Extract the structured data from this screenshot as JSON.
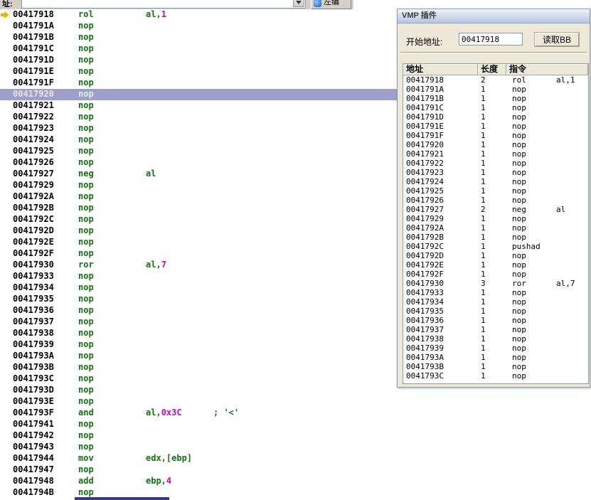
{
  "toolbar": {
    "address_label": "址:",
    "combo_value": "",
    "button_label": "左编"
  },
  "colors": {
    "mnemonic_green": "#0e750e",
    "operand_number_magenta": "#cc00cc",
    "highlight_row_lavender": "#9f9fcc",
    "eip_arrow_gold": "#f0b400",
    "selection_blue": "#34349c",
    "dialog_background": "#ece9d8"
  },
  "disassembly": {
    "lines": [
      {
        "addr": "00417918",
        "mn": "rol",
        "op": [
          {
            "t": "al,",
            "c": "reg"
          },
          {
            "t": "1",
            "c": "num"
          }
        ],
        "arrow": true
      },
      {
        "addr": "0041791A",
        "mn": "nop"
      },
      {
        "addr": "0041791B",
        "mn": "nop"
      },
      {
        "addr": "0041791C",
        "mn": "nop"
      },
      {
        "addr": "0041791D",
        "mn": "nop"
      },
      {
        "addr": "0041791E",
        "mn": "nop"
      },
      {
        "addr": "0041791F",
        "mn": "nop"
      },
      {
        "addr": "00417920",
        "mn": "nop",
        "hl": true
      },
      {
        "addr": "00417921",
        "mn": "nop"
      },
      {
        "addr": "00417922",
        "mn": "nop"
      },
      {
        "addr": "00417923",
        "mn": "nop"
      },
      {
        "addr": "00417924",
        "mn": "nop"
      },
      {
        "addr": "00417925",
        "mn": "nop"
      },
      {
        "addr": "00417926",
        "mn": "nop"
      },
      {
        "addr": "00417927",
        "mn": "neg",
        "op": [
          {
            "t": "al",
            "c": "reg"
          }
        ]
      },
      {
        "addr": "00417929",
        "mn": "nop"
      },
      {
        "addr": "0041792A",
        "mn": "nop"
      },
      {
        "addr": "0041792B",
        "mn": "nop"
      },
      {
        "addr": "0041792C",
        "mn": "nop"
      },
      {
        "addr": "0041792D",
        "mn": "nop"
      },
      {
        "addr": "0041792E",
        "mn": "nop"
      },
      {
        "addr": "0041792F",
        "mn": "nop"
      },
      {
        "addr": "00417930",
        "mn": "ror",
        "op": [
          {
            "t": "al,",
            "c": "reg"
          },
          {
            "t": "7",
            "c": "num"
          }
        ]
      },
      {
        "addr": "00417933",
        "mn": "nop"
      },
      {
        "addr": "00417934",
        "mn": "nop"
      },
      {
        "addr": "00417935",
        "mn": "nop"
      },
      {
        "addr": "00417936",
        "mn": "nop"
      },
      {
        "addr": "00417937",
        "mn": "nop"
      },
      {
        "addr": "00417938",
        "mn": "nop"
      },
      {
        "addr": "00417939",
        "mn": "nop"
      },
      {
        "addr": "0041793A",
        "mn": "nop"
      },
      {
        "addr": "0041793B",
        "mn": "nop"
      },
      {
        "addr": "0041793C",
        "mn": "nop"
      },
      {
        "addr": "0041793D",
        "mn": "nop"
      },
      {
        "addr": "0041793E",
        "mn": "nop"
      },
      {
        "addr": "0041793F",
        "mn": "and",
        "op": [
          {
            "t": "al,",
            "c": "reg"
          },
          {
            "t": "0x3C",
            "c": "num"
          }
        ],
        "comment": "; '<'"
      },
      {
        "addr": "00417941",
        "mn": "nop"
      },
      {
        "addr": "00417942",
        "mn": "nop"
      },
      {
        "addr": "00417943",
        "mn": "nop"
      },
      {
        "addr": "00417944",
        "mn": "mov",
        "op": [
          {
            "t": "edx,[ebp]",
            "c": "reg"
          }
        ]
      },
      {
        "addr": "00417947",
        "mn": "nop"
      },
      {
        "addr": "00417948",
        "mn": "add",
        "op": [
          {
            "t": "ebp,",
            "c": "reg"
          },
          {
            "t": "4",
            "c": "num"
          }
        ]
      },
      {
        "addr": "0041794B",
        "mn": "nop"
      }
    ]
  },
  "dialog": {
    "title": "VMP 插件",
    "start_label": "开始地址:",
    "start_value": "00417918",
    "read_button": "读取BB",
    "table": {
      "headers": [
        "地址",
        "长度",
        "指令"
      ],
      "rows": [
        [
          "00417918",
          "2",
          "rol",
          "al,1"
        ],
        [
          "0041791A",
          "1",
          "nop",
          ""
        ],
        [
          "0041791B",
          "1",
          "nop",
          ""
        ],
        [
          "0041791C",
          "1",
          "nop",
          ""
        ],
        [
          "0041791D",
          "1",
          "nop",
          ""
        ],
        [
          "0041791E",
          "1",
          "nop",
          ""
        ],
        [
          "0041791F",
          "1",
          "nop",
          ""
        ],
        [
          "00417920",
          "1",
          "nop",
          ""
        ],
        [
          "00417921",
          "1",
          "nop",
          ""
        ],
        [
          "00417922",
          "1",
          "nop",
          ""
        ],
        [
          "00417923",
          "1",
          "nop",
          ""
        ],
        [
          "00417924",
          "1",
          "nop",
          ""
        ],
        [
          "00417925",
          "1",
          "nop",
          ""
        ],
        [
          "00417926",
          "1",
          "nop",
          ""
        ],
        [
          "00417927",
          "2",
          "neg",
          "al"
        ],
        [
          "00417929",
          "1",
          "nop",
          ""
        ],
        [
          "0041792A",
          "1",
          "nop",
          ""
        ],
        [
          "0041792B",
          "1",
          "nop",
          ""
        ],
        [
          "0041792C",
          "1",
          "pushad",
          ""
        ],
        [
          "0041792D",
          "1",
          "nop",
          ""
        ],
        [
          "0041792E",
          "1",
          "nop",
          ""
        ],
        [
          "0041792F",
          "1",
          "nop",
          ""
        ],
        [
          "00417930",
          "3",
          "ror",
          "al,7"
        ],
        [
          "00417933",
          "1",
          "nop",
          ""
        ],
        [
          "00417934",
          "1",
          "nop",
          ""
        ],
        [
          "00417935",
          "1",
          "nop",
          ""
        ],
        [
          "00417936",
          "1",
          "nop",
          ""
        ],
        [
          "00417937",
          "1",
          "nop",
          ""
        ],
        [
          "00417938",
          "1",
          "nop",
          ""
        ],
        [
          "00417939",
          "1",
          "nop",
          ""
        ],
        [
          "0041793A",
          "1",
          "nop",
          ""
        ],
        [
          "0041793B",
          "1",
          "nop",
          ""
        ],
        [
          "0041793C",
          "1",
          "nop",
          ""
        ]
      ]
    }
  }
}
